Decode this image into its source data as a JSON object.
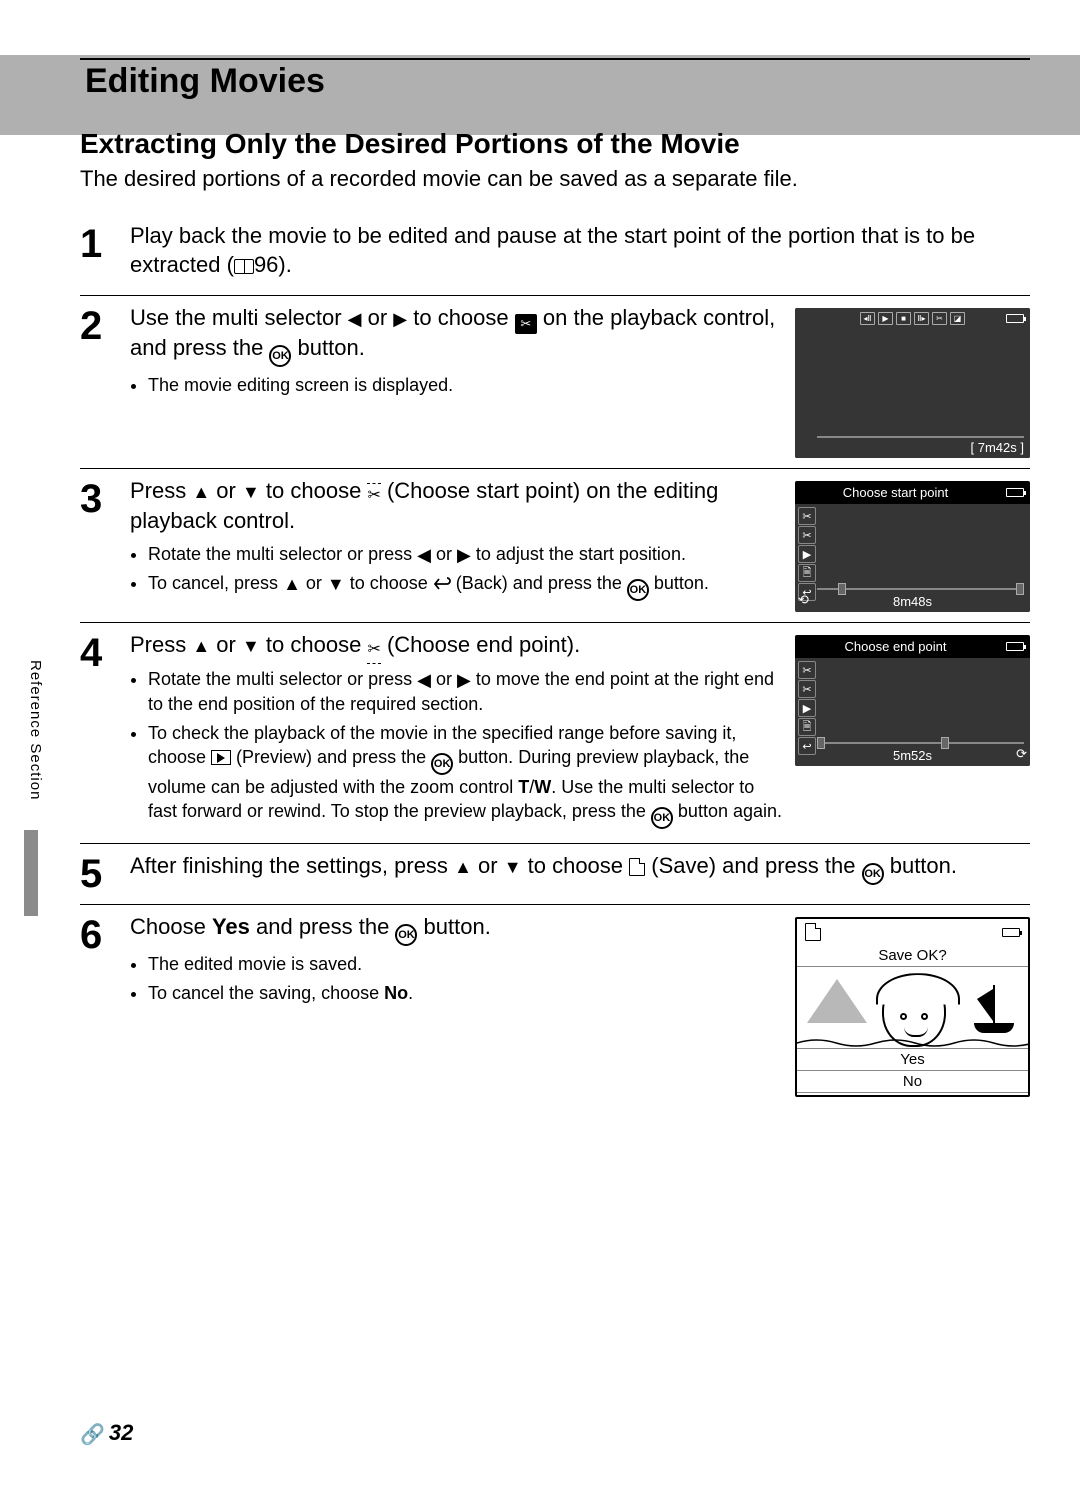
{
  "page": {
    "title": "Editing Movies",
    "subtitle": "Extracting Only the Desired Portions of the Movie",
    "intro": "The desired portions of a recorded movie can be saved as a separate file.",
    "side_tab": "Reference Section",
    "footer_page": "32"
  },
  "steps": [
    {
      "num": "1",
      "main_pre": "Play back the movie to be edited and pause at the start point of the portion that is to be extracted (",
      "main_ref": "96",
      "main_post": ")."
    },
    {
      "num": "2",
      "main": "Use the multi selector ◀ or ▶ to choose ✂ on the playback control, and press the OK button.",
      "bullets": [
        "The movie editing screen is displayed."
      ],
      "shot": {
        "time_br": "7m42s"
      }
    },
    {
      "num": "3",
      "main": "Press ▲ or ▼ to choose ✂ (Choose start point) on the editing playback control.",
      "bullets": [
        "Rotate the multi selector or press ◀ or ▶ to adjust the start position.",
        "To cancel, press ▲ or ▼ to choose ↩ (Back) and press the OK button."
      ],
      "shot": {
        "title": "Choose start point",
        "time": "8m48s"
      }
    },
    {
      "num": "4",
      "main": "Press ▲ or ▼ to choose ✂ (Choose end point).",
      "bullets": [
        "Rotate the multi selector or press ◀ or ▶ to move the end point at the right end to the end position of the required section.",
        "To check the playback of the movie in the specified range before saving it, choose ▶ (Preview) and press the OK button. During preview playback, the volume can be adjusted with the zoom control T/W. Use the multi selector to fast forward or rewind. To stop the preview playback, press the OK button again."
      ],
      "shot": {
        "title": "Choose end point",
        "time": "5m52s"
      }
    },
    {
      "num": "5",
      "main": "After finishing the settings, press ▲ or ▼ to choose 🗎 (Save) and press the OK button."
    },
    {
      "num": "6",
      "main_pre": "Choose ",
      "main_bold": "Yes",
      "main_post": " and press the OK button.",
      "bullets": [
        "The edited movie is saved.",
        "To cancel the saving, choose No."
      ],
      "dialog": {
        "title": "Save OK?",
        "yes": "Yes",
        "no": "No"
      }
    }
  ]
}
